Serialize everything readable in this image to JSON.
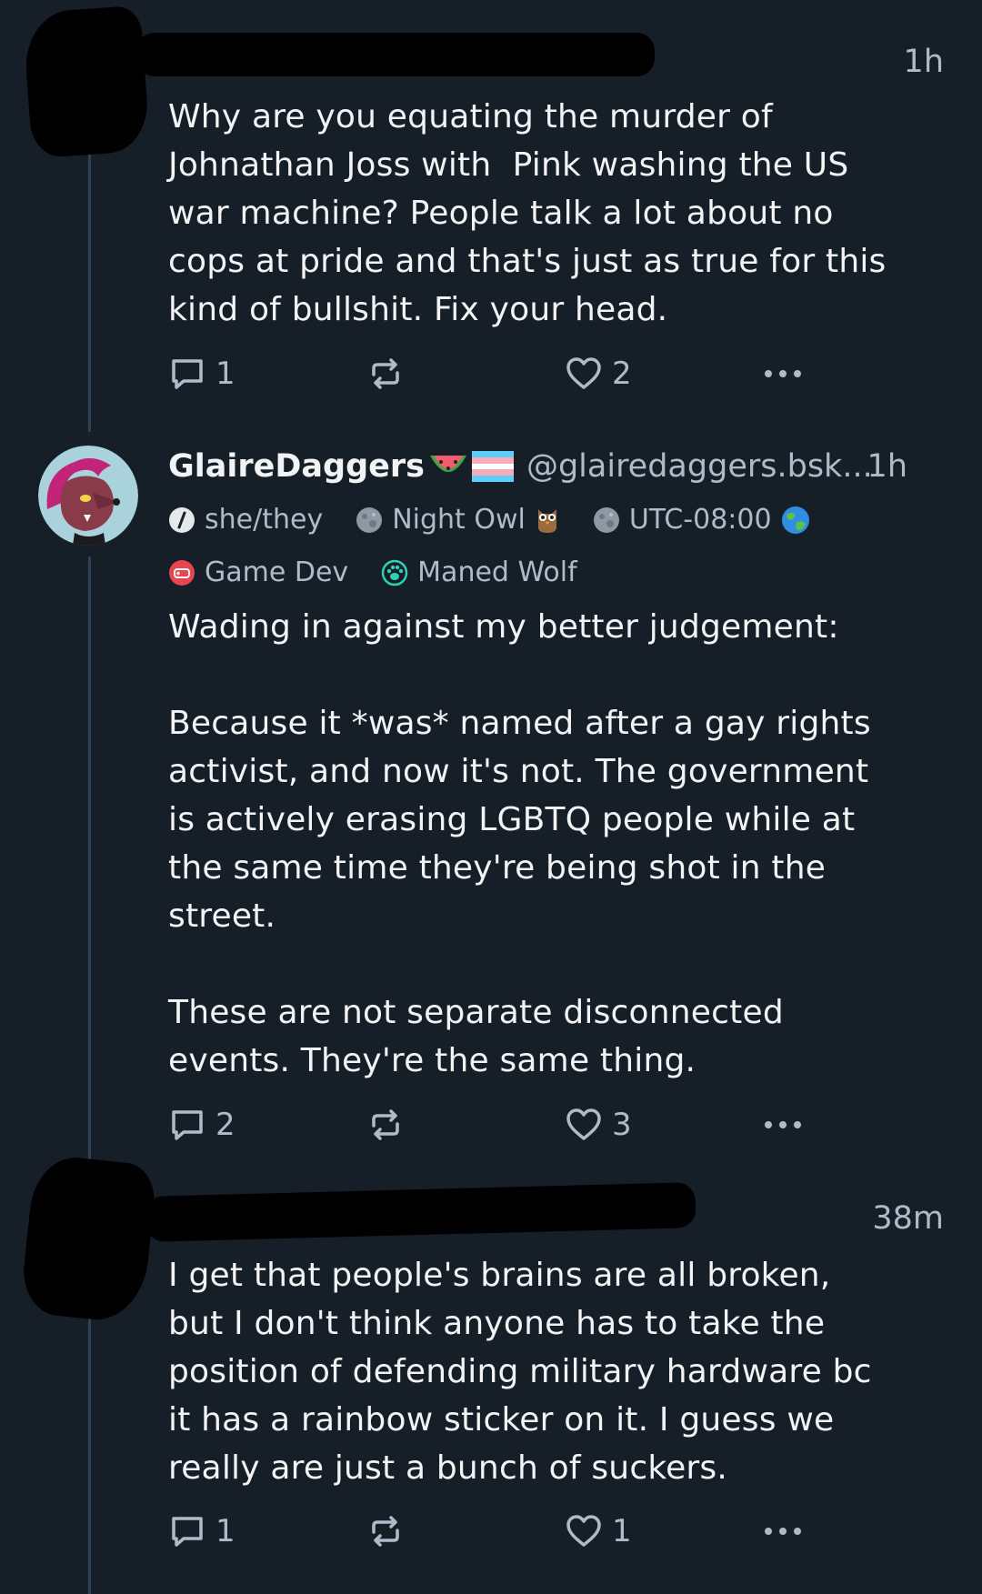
{
  "posts": [
    {
      "time": "1h",
      "text": "Why are you equating the murder of\nJohnathan Joss with  Pink washing the US\nwar machine? People talk a lot about no\ncops at pride and that's just as true for this\nkind of bullshit. Fix your head.",
      "replies": "1",
      "likes": "2"
    },
    {
      "author_name": "GlaireDaggers",
      "author_emojis": [
        "watermelon-emoji",
        "trans-flag-emoji"
      ],
      "handle": "@glairedaggers.bsk...",
      "time": "1h",
      "badges": [
        {
          "label": "she/they",
          "icon": "pronoun-badge-icon"
        },
        {
          "label": "Night Owl",
          "icon": "moon-globe-icon",
          "trail_icon": "owl-icon"
        },
        {
          "label": "UTC-08:00",
          "icon": "moon-globe-icon",
          "trail_icon": "earth-globe-icon"
        },
        {
          "label": "Game Dev",
          "icon": "gamepad-badge-icon"
        },
        {
          "label": "Maned Wolf",
          "icon": "paw-badge-icon"
        }
      ],
      "text": "Wading in against my better judgement:\n\nBecause it *was* named after a gay rights\nactivist, and now it's not. The government\nis actively erasing LGBTQ people while at\nthe same time they're being shot in the\nstreet.\n\nThese are not separate disconnected\nevents. They're the same thing.",
      "replies": "2",
      "likes": "3"
    },
    {
      "time": "38m",
      "text": "I get that people's brains are all broken,\nbut I don't think anyone has to take the\nposition of defending military hardware bc\nit has a rainbow sticker on it. I guess we\nreally are just a bunch of suckers.",
      "replies": "1",
      "likes": "1"
    }
  ],
  "colors": {
    "background": "#161e27",
    "text": "#f1f3f5",
    "muted": "#aebbc9",
    "thread_line": "#2e4052",
    "game_dev_badge": "#e8454f",
    "maned_wolf_badge": "#2fd1b5"
  }
}
